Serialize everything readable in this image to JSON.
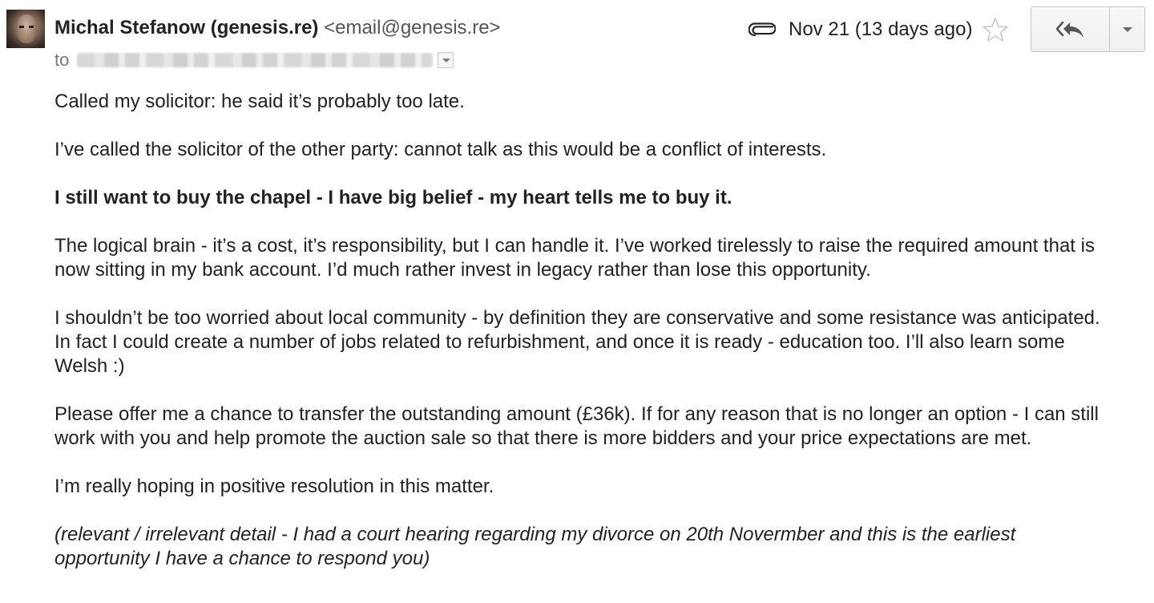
{
  "sender": {
    "name": "Michal Stefanow (genesis.re)",
    "email": "<email@genesis.re>"
  },
  "recipients": {
    "label": "to"
  },
  "meta": {
    "date": "Nov 21 (13 days ago)",
    "icons": [
      "paperclip-icon",
      "star-icon",
      "reply-all-icon",
      "chevron-down-icon"
    ]
  },
  "body": {
    "paragraphs": [
      "Called my solicitor: he said it’s probably too late.",
      "I’ve called the solicitor of the other party: cannot talk as this would be a conflict of interests.",
      "I still want to buy the chapel - I have big belief - my heart tells me to buy it.",
      "The logical brain - it’s a cost, it’s responsibility, but I can handle it. I’ve worked tirelessly to raise the required amount that is now sitting in my bank account. I’d much rather invest in legacy rather than lose this opportunity.",
      "I shouldn’t be too worried about local community - by definition they are conservative and some resistance was anticipated. In fact I could create a number of jobs related to refurbishment, and once it is ready - education too. I’ll also learn some Welsh :)",
      "Please offer me a chance to transfer the outstanding amount (£36k). If for any reason that is no longer an option - I can still work with you and help promote the auction sale so that there is more bidders and your price expectations are met.",
      "I’m really hoping in positive resolution in this matter.",
      "(relevant / irrelevant detail - I had a court hearing regarding my divorce on 20th Novermber and this is the earliest opportunity I have a chance to respond you)"
    ]
  }
}
